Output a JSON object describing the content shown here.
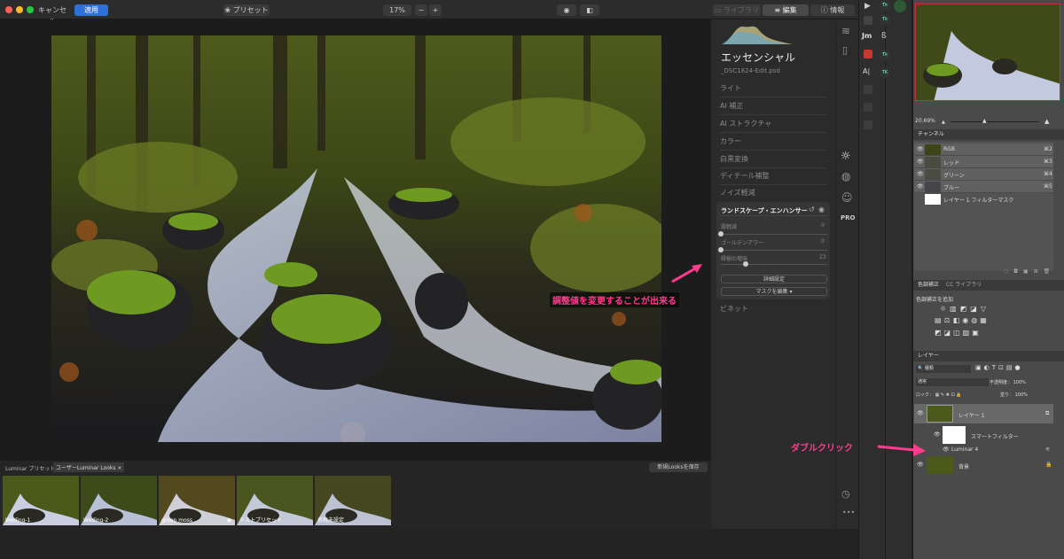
{
  "luminar": {
    "top": {
      "cancel": "キャンセル",
      "apply": "適用",
      "presets": "プリセット",
      "zoom": "17%",
      "zoom_minus": "−",
      "zoom_plus": "+",
      "tab_library": "ライブラリ",
      "tab_edit": "編集",
      "tab_info": "情報"
    },
    "side": {
      "title": "エッセンシャル",
      "filename": "_DSC1824-Edit.psd",
      "items": [
        "ライト",
        "AI 補正",
        "AI ストラクチャ",
        "カラー",
        "白黒変換",
        "ディテール補整",
        "ノイズ軽減"
      ],
      "bottom_item": "ビネット"
    },
    "panel": {
      "title": "ランドスケープ・エンハンサー",
      "sliders": [
        {
          "label": "霧軽減",
          "value": "0",
          "level": 0
        },
        {
          "label": "ゴールデンアワー",
          "value": "0",
          "level": 0
        },
        {
          "label": "緑樹の増強",
          "value": "23",
          "level": 0.23
        }
      ],
      "advanced": "詳細設定",
      "mask": "マスクを編集 ▾"
    },
    "film": {
      "tab1": "Luminar プリセット",
      "tab2": "ユーザーLuminar Looks",
      "tab2_close": "×",
      "save": "新規Looksを保存",
      "thumbs": [
        "Weding-1",
        "Weding-2",
        "green moss",
        "テストプリセット",
        "名称未設定"
      ],
      "star": "★"
    },
    "tool_icons": [
      "layers-icon",
      "compare-icon",
      "sun-icon",
      "palette-icon",
      "face-icon",
      "pro-icon",
      "history-icon",
      "more-icon"
    ],
    "pro_label": "PRO"
  },
  "photoshop": {
    "tools_col1": [
      "▶",
      "Jm",
      "A|"
    ],
    "tools_col2": [
      "Tk",
      "Tk",
      "ß",
      "Tk",
      "TK"
    ],
    "navigator_zoom": "20.69%",
    "channels": {
      "tab": "チャンネル",
      "rows": [
        {
          "name": "RGB",
          "key": "⌘2"
        },
        {
          "name": "レッド",
          "key": "⌘3"
        },
        {
          "name": "グリーン",
          "key": "⌘4"
        },
        {
          "name": "ブルー",
          "key": "⌘5"
        }
      ],
      "mask_row": "レイヤー 1 フィルターマスク"
    },
    "adjust": {
      "tab1": "色調補正",
      "tab2": "CC ライブラリ",
      "hint": "色調補正を追加"
    },
    "layers": {
      "tab": "レイヤー",
      "kind": "種類",
      "blend": "通常",
      "opacity_label": "不透明度：",
      "opacity": "100%",
      "lock_label": "ロック：",
      "fill_label": "塗り：",
      "fill": "100%",
      "layer1": "レイヤー 1",
      "smart_filter": "スマートフィルター",
      "luminar": "Luminar 4",
      "background": "背景"
    }
  },
  "annotations": {
    "adjust_note": "調整値を変更することが出来る",
    "dbl_click": "ダブルクリック"
  },
  "colors": {
    "accent_blue": "#2f6fd8",
    "annotation_pink": "#ff3c8e",
    "ps_panel": "#4a4a4a"
  }
}
